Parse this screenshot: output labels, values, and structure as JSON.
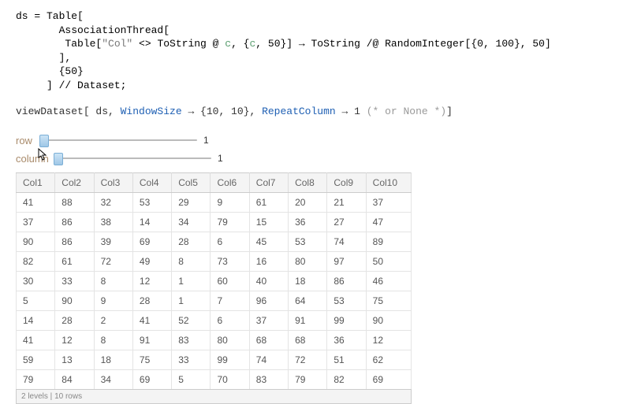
{
  "code1": {
    "line1a": "ds = Table[",
    "line2a": "       AssociationThread[",
    "line3_pre": "        Table[",
    "line3_str": "\"Col\"",
    "line3_mid1": " <> ToString @ ",
    "line3_c": "c",
    "line3_mid2": ", {",
    "line3_c2": "c",
    "line3_end": ", 50}] → ToString /@ RandomInteger[{0, 100}, 50]",
    "line4": "       ],",
    "line5": "       {50}",
    "line6": "     ] // Dataset;"
  },
  "code2": {
    "pre": "viewDataset[ ds, ",
    "ws": "WindowSize",
    "arrow": " → {10, 10}, ",
    "rc": "RepeatColumn",
    "arrow2": " → 1 ",
    "cmt": "(* or None *)",
    "end": "]"
  },
  "sliders": {
    "row": {
      "label": "row",
      "value": "1"
    },
    "col": {
      "label": "column",
      "value": "1"
    }
  },
  "table": {
    "headers": [
      "Col1",
      "Col2",
      "Col3",
      "Col4",
      "Col5",
      "Col6",
      "Col7",
      "Col8",
      "Col9",
      "Col10"
    ],
    "rows": [
      [
        "41",
        "88",
        "32",
        "53",
        "29",
        "9",
        "61",
        "20",
        "21",
        "37"
      ],
      [
        "37",
        "86",
        "38",
        "14",
        "34",
        "79",
        "15",
        "36",
        "27",
        "47"
      ],
      [
        "90",
        "86",
        "39",
        "69",
        "28",
        "6",
        "45",
        "53",
        "74",
        "89"
      ],
      [
        "82",
        "61",
        "72",
        "49",
        "8",
        "73",
        "16",
        "80",
        "97",
        "50"
      ],
      [
        "30",
        "33",
        "8",
        "12",
        "1",
        "60",
        "40",
        "18",
        "86",
        "46"
      ],
      [
        "5",
        "90",
        "9",
        "28",
        "1",
        "7",
        "96",
        "64",
        "53",
        "75"
      ],
      [
        "14",
        "28",
        "2",
        "41",
        "52",
        "6",
        "37",
        "91",
        "99",
        "90"
      ],
      [
        "41",
        "12",
        "8",
        "91",
        "83",
        "80",
        "68",
        "68",
        "36",
        "12"
      ],
      [
        "59",
        "13",
        "18",
        "75",
        "33",
        "99",
        "74",
        "72",
        "51",
        "62"
      ],
      [
        "79",
        "84",
        "34",
        "69",
        "5",
        "70",
        "83",
        "79",
        "82",
        "69"
      ]
    ]
  },
  "footer": {
    "levels": "2 levels",
    "rows": "10 rows",
    "sep": "  |  "
  }
}
